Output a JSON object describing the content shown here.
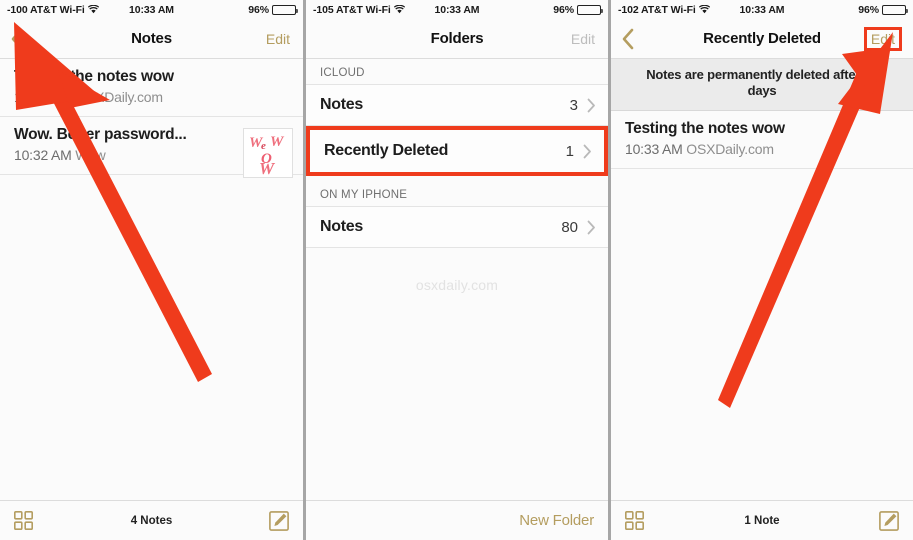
{
  "accent_gold": "#b49d5f",
  "annotation_red": "#ef3b1c",
  "panels": [
    {
      "id": "notes-list",
      "status": {
        "carrier": "-100 AT&T Wi-Fi",
        "time": "10:33 AM",
        "battery": "96%"
      },
      "nav": {
        "title": "Notes",
        "edit_label": "Edit",
        "has_back": true,
        "edit_state": "normal"
      },
      "notes": [
        {
          "title": "Testing the notes wow",
          "time": "10:33 AM",
          "preview": "OSXDaily.com",
          "thumb": null
        },
        {
          "title": "Wow. Better password...",
          "time": "10:32 AM",
          "preview": "Wow",
          "thumb": "wow-sketch"
        }
      ],
      "toolbar": {
        "grid_icon": "grid-icon",
        "label": "4 Notes",
        "compose_icon": "compose-icon"
      }
    },
    {
      "id": "folders-list",
      "status": {
        "carrier": "-105 AT&T Wi-Fi",
        "time": "10:33 AM",
        "battery": "96%"
      },
      "nav": {
        "title": "Folders",
        "edit_label": "Edit",
        "has_back": false,
        "edit_state": "dimmed"
      },
      "sections": [
        {
          "header": "ICLOUD",
          "rows": [
            {
              "name": "Notes",
              "count": "3",
              "highlighted": false
            },
            {
              "name": "Recently Deleted",
              "count": "1",
              "highlighted": true
            }
          ]
        },
        {
          "header": "ON MY IPHONE",
          "rows": [
            {
              "name": "Notes",
              "count": "80",
              "highlighted": false
            }
          ]
        }
      ],
      "watermark": "osxdaily.com",
      "toolbar": {
        "new_folder_label": "New Folder"
      }
    },
    {
      "id": "recently-deleted",
      "status": {
        "carrier": "-102 AT&T Wi-Fi",
        "time": "10:33 AM",
        "battery": "96%"
      },
      "nav": {
        "title": "Recently Deleted",
        "edit_label": "Edit",
        "has_back": true,
        "edit_state": "boxed"
      },
      "banner": "Notes are permanently deleted after 30 days",
      "notes": [
        {
          "title": "Testing the notes wow",
          "time": "10:33 AM",
          "preview": "OSXDaily.com",
          "thumb": null
        }
      ],
      "toolbar": {
        "grid_icon": "grid-icon",
        "label": "1 Note",
        "compose_icon": "compose-icon"
      }
    }
  ]
}
